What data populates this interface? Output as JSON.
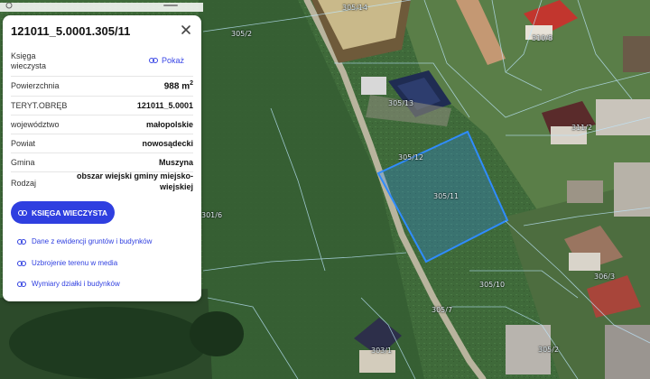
{
  "panel": {
    "title": "121011_5.0001.305/11",
    "rows": [
      {
        "key": "Księga\nwieczysta",
        "link": "Pokaż"
      },
      {
        "key": "Powierzchnia",
        "value": "988 m",
        "sup": "2"
      },
      {
        "key": "TERYT.OBRĘB",
        "value": "121011_5.0001"
      },
      {
        "key": "województwo",
        "value": "małopolskie"
      },
      {
        "key": "Powiat",
        "value": "nowosądecki"
      },
      {
        "key": "Gmina",
        "value": "Muszyna"
      },
      {
        "key": "Rodzaj",
        "value": "obszar wiejski gminy miejsko-\nwiejskiej"
      }
    ],
    "main_button": "KSIĘGA WIECZYSTA",
    "links": [
      "Dane z ewidencji gruntów i budynków",
      "Uzbrojenie terenu w media",
      "Wymiary działki i budynków"
    ]
  },
  "map": {
    "highlight_color": "#2f8cff",
    "parcel_labels": [
      {
        "id": "305/14"
      },
      {
        "id": "305/2"
      },
      {
        "id": "310/8"
      },
      {
        "id": "305/13"
      },
      {
        "id": "311/2"
      },
      {
        "id": "305/12"
      },
      {
        "id": "305/11"
      },
      {
        "id": "301/6"
      },
      {
        "id": "306/3"
      },
      {
        "id": "305/10"
      },
      {
        "id": "305/7"
      },
      {
        "id": "303/1"
      },
      {
        "id": "305/2"
      }
    ]
  }
}
